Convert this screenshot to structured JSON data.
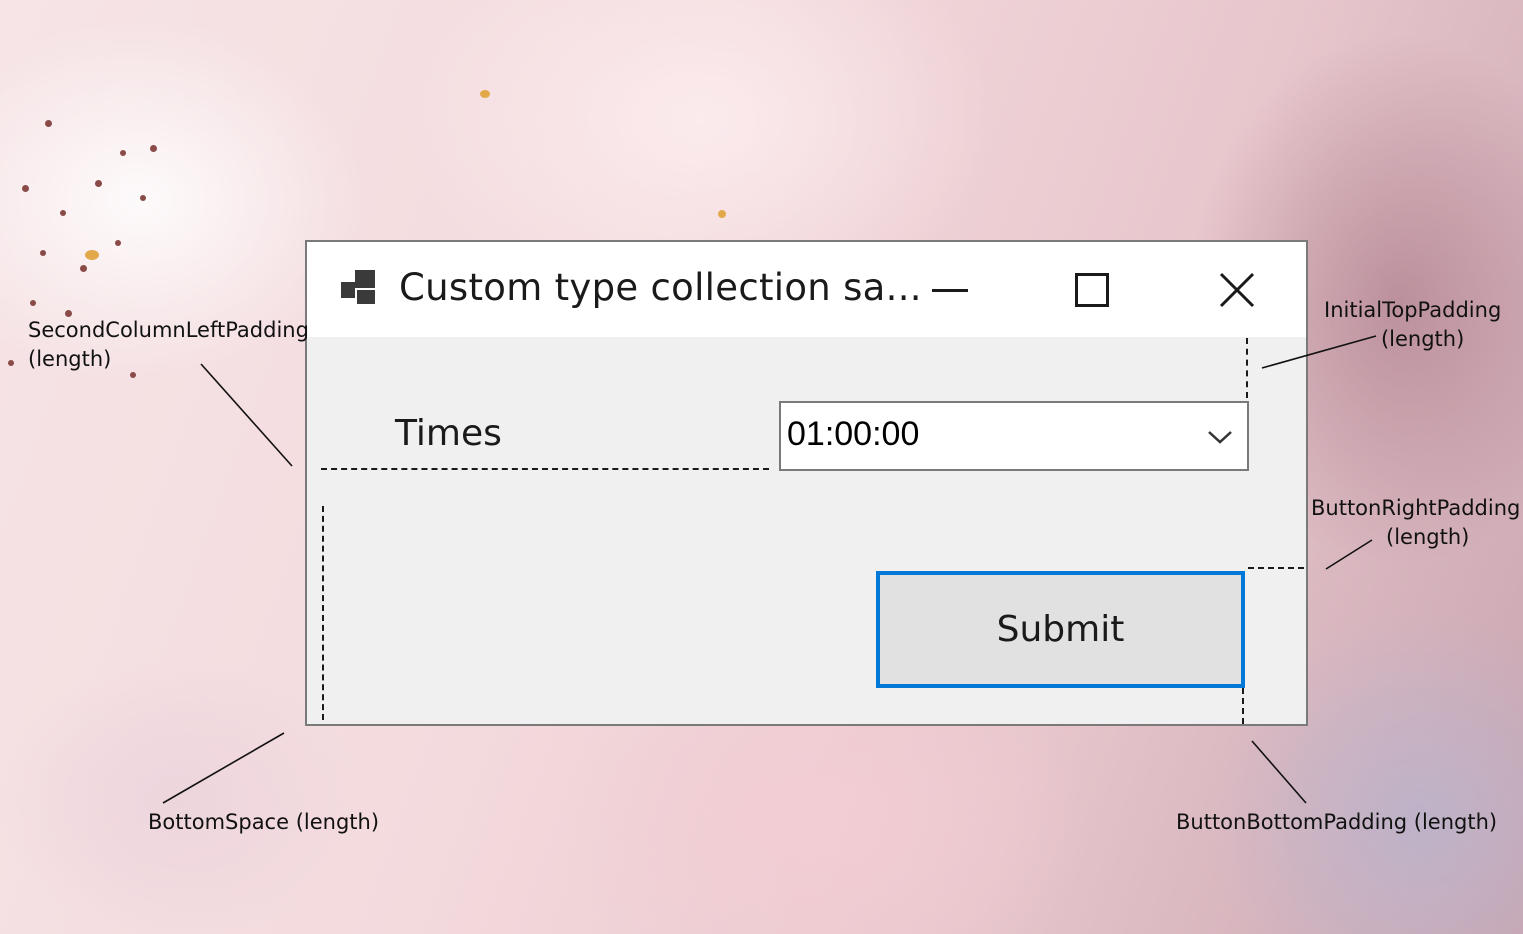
{
  "window": {
    "title": "Custom type collection sa...",
    "icon": "app-form-icon",
    "controls": {
      "minimize": "minimize-icon",
      "maximize": "maximize-icon",
      "close": "close-icon"
    }
  },
  "form": {
    "times_label": "Times",
    "times_value": "01:00:00",
    "dropdown_icon": "chevron-down-icon",
    "submit_label": "Submit"
  },
  "annotations": {
    "second_column_left_padding": {
      "line1": "SecondColumnLeftPadding",
      "line2": "(length)"
    },
    "initial_top_padding": {
      "line1": "InitialTopPadding",
      "line2": "(length)"
    },
    "button_right_padding": {
      "line1": "ButtonRightPadding",
      "line2": "(length)"
    },
    "bottom_space": "BottomSpace (length)",
    "button_bottom_padding": "ButtonBottomPadding (length)"
  },
  "colors": {
    "accent_focus": "#0078d7",
    "window_bg": "#f0f0f0",
    "button_bg": "#e1e1e1"
  }
}
